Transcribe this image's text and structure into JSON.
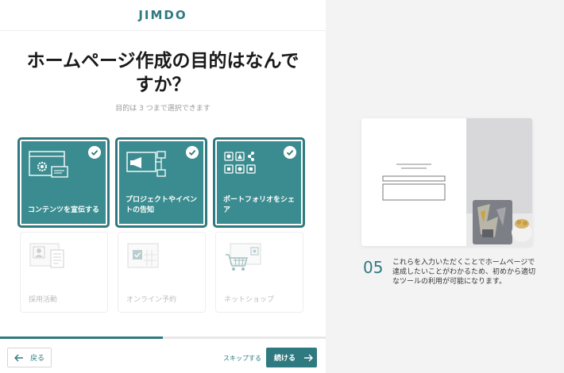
{
  "brand": {
    "logo": "JIMDO",
    "accent": "#2e7a80"
  },
  "heading": {
    "title": "ホームページ作成の目的はなんですか？",
    "subtitle": "目的は 3 つまで選択できます"
  },
  "options": [
    {
      "label": "コンテンツを宣伝する",
      "selected": true,
      "icon": "browser-settings-icon"
    },
    {
      "label": "プロジェクトやイベントの告知",
      "selected": true,
      "icon": "megaphone-flow-icon"
    },
    {
      "label": "ポートフォリオをシェア",
      "selected": true,
      "icon": "portfolio-grid-icon"
    },
    {
      "label": "採用活動",
      "selected": false,
      "icon": "resume-icon"
    },
    {
      "label": "オンライン予約",
      "selected": false,
      "icon": "calendar-icon"
    },
    {
      "label": "ネットショップ",
      "selected": false,
      "icon": "shopping-cart-icon"
    }
  ],
  "progress": {
    "fraction": 0.5
  },
  "footer": {
    "back_label": "戻る",
    "skip_label": "スキップする",
    "next_label": "続ける"
  },
  "side": {
    "step_number": "05",
    "description": "これらを入力いただくことでホームページで達成したいことがわかるため、初めから適切なツールの利用が可能になります。"
  }
}
